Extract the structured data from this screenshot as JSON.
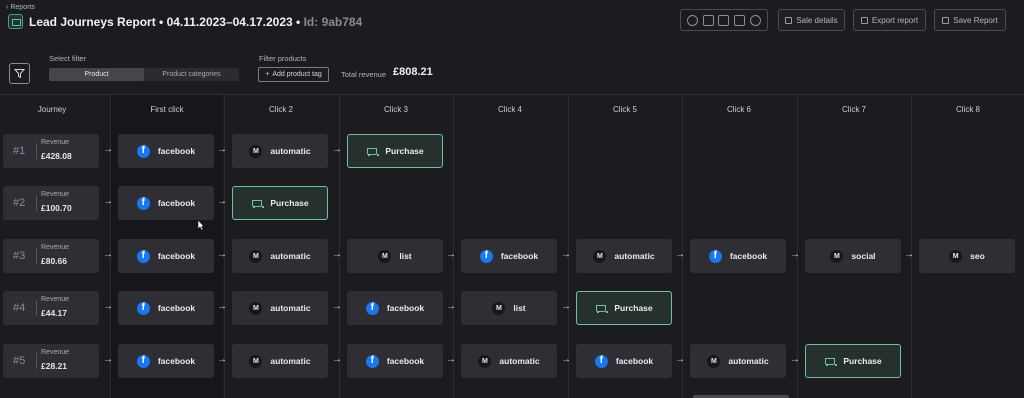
{
  "header": {
    "back_label": "Reports",
    "title": "Lead Journeys Report • 04.11.2023–04.17.2023 • ",
    "id_label": "Id: 9ab784",
    "buttons": {
      "sale_details": "Sale details",
      "export_report": "Export report",
      "save_report": "Save Report"
    },
    "toolbar_icons": [
      "dollar-icon",
      "link-icon",
      "tag-icon",
      "calendar-icon",
      "globe-icon"
    ]
  },
  "filters": {
    "select_filter_label": "Select filter",
    "tabs": [
      "Product",
      "Product categories"
    ],
    "active_tab": "Product",
    "filter_products_label": "Filter products",
    "add_tag_label": "Add product tag",
    "total_revenue_label": "Total revenue",
    "total_revenue_value": "£808.21"
  },
  "columns": [
    "Journey",
    "First click",
    "Click 2",
    "Click 3",
    "Click 4",
    "Click 5",
    "Click 6",
    "Click 7",
    "Click 8"
  ],
  "revenue_label": "Revenue",
  "journeys": [
    {
      "num": "#1",
      "revenue": "£428.08",
      "steps": [
        {
          "type": "facebook",
          "label": "facebook"
        },
        {
          "type": "channel",
          "label": "automatic"
        },
        {
          "type": "purchase",
          "label": "Purchase"
        }
      ]
    },
    {
      "num": "#2",
      "revenue": "£100.70",
      "steps": [
        {
          "type": "facebook",
          "label": "facebook"
        },
        {
          "type": "purchase",
          "label": "Purchase"
        }
      ]
    },
    {
      "num": "#3",
      "revenue": "£80.66",
      "steps": [
        {
          "type": "facebook",
          "label": "facebook"
        },
        {
          "type": "channel",
          "label": "automatic"
        },
        {
          "type": "channel",
          "label": "list"
        },
        {
          "type": "facebook",
          "label": "facebook"
        },
        {
          "type": "channel",
          "label": "automatic"
        },
        {
          "type": "facebook",
          "label": "facebook"
        },
        {
          "type": "channel",
          "label": "social"
        },
        {
          "type": "channel",
          "label": "seo"
        }
      ]
    },
    {
      "num": "#4",
      "revenue": "£44.17",
      "steps": [
        {
          "type": "facebook",
          "label": "facebook"
        },
        {
          "type": "channel",
          "label": "automatic"
        },
        {
          "type": "facebook",
          "label": "facebook"
        },
        {
          "type": "channel",
          "label": "list"
        },
        {
          "type": "purchase",
          "label": "Purchase"
        }
      ]
    },
    {
      "num": "#5",
      "revenue": "£28.21",
      "steps": [
        {
          "type": "facebook",
          "label": "facebook"
        },
        {
          "type": "channel",
          "label": "automatic"
        },
        {
          "type": "facebook",
          "label": "facebook"
        },
        {
          "type": "channel",
          "label": "automatic"
        },
        {
          "type": "facebook",
          "label": "facebook"
        },
        {
          "type": "channel",
          "label": "automatic"
        },
        {
          "type": "purchase",
          "label": "Purchase"
        }
      ]
    }
  ],
  "colors": {
    "accent": "#6fc2a4",
    "facebook": "#1877f2",
    "background": "#1b1b20",
    "card": "#2e2e34"
  }
}
